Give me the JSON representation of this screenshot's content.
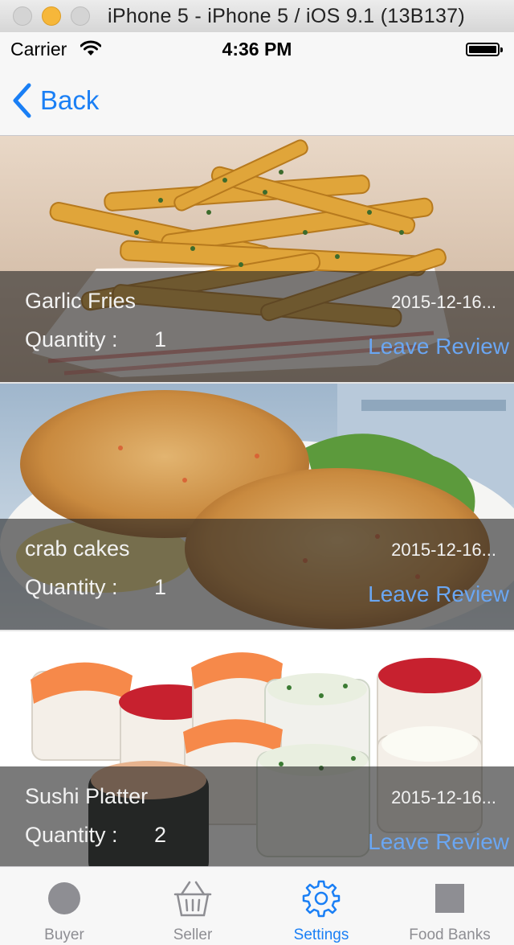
{
  "window": {
    "title": "iPhone 5 - iPhone 5 / iOS 9.1 (13B137)"
  },
  "status_bar": {
    "carrier": "Carrier",
    "time": "4:36 PM"
  },
  "nav": {
    "back_label": "Back"
  },
  "orders": [
    {
      "name": "Garlic Fries",
      "date": "2015-12-16...",
      "quantity_label": "Quantity :",
      "quantity": "1",
      "action": "Leave Review",
      "image": "garlic-fries-photo"
    },
    {
      "name": "crab cakes",
      "date": "2015-12-16...",
      "quantity_label": "Quantity :",
      "quantity": "1",
      "action": "Leave Review",
      "image": "crab-cakes-photo"
    },
    {
      "name": "Sushi Platter",
      "date": "2015-12-16...",
      "quantity_label": "Quantity :",
      "quantity": "2",
      "action": "Leave Review",
      "image": "sushi-platter-photo"
    }
  ],
  "tabs": [
    {
      "label": "Buyer",
      "icon": "circle-icon",
      "active": false
    },
    {
      "label": "Seller",
      "icon": "basket-icon",
      "active": false
    },
    {
      "label": "Settings",
      "icon": "gear-icon",
      "active": true
    },
    {
      "label": "Food Banks",
      "icon": "square-icon",
      "active": false
    }
  ],
  "colors": {
    "accent": "#1a7ff5",
    "review_link": "#6aa6f2",
    "inactive_tab": "#8e8e93"
  }
}
